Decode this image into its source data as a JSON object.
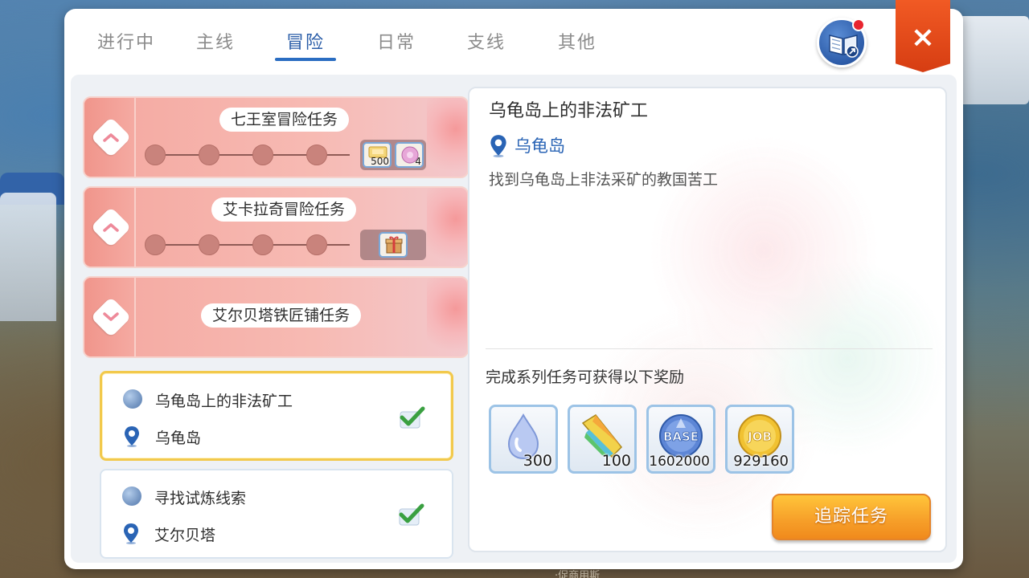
{
  "tabs": [
    {
      "label": "进行中",
      "active": false
    },
    {
      "label": "主线",
      "active": false
    },
    {
      "label": "冒险",
      "active": true
    },
    {
      "label": "日常",
      "active": false
    },
    {
      "label": "支线",
      "active": false
    },
    {
      "label": "其他",
      "active": false
    }
  ],
  "close_label": "×",
  "quest_groups": [
    {
      "title": "七王室冒险任务",
      "expanded": true,
      "reward_counts": [
        "500",
        "4"
      ]
    },
    {
      "title": "艾卡拉奇冒险任务",
      "expanded": true,
      "reward_counts": []
    },
    {
      "title": "艾尔贝塔铁匠铺任务",
      "expanded": false,
      "reward_counts": []
    }
  ],
  "quest_items": [
    {
      "name": "乌龟岛上的非法矿工",
      "location": "乌龟岛",
      "completed": true,
      "selected": true
    },
    {
      "name": "寻找试炼线索",
      "location": "艾尔贝塔",
      "completed": true,
      "selected": false
    }
  ],
  "detail": {
    "title": "乌龟岛上的非法矿工",
    "location": "乌龟岛",
    "description": "找到乌龟岛上非法采矿的教国苦工",
    "reward_title": "完成系列任务可获得以下奖励",
    "rewards": [
      {
        "icon": "droplet-icon",
        "value": "300"
      },
      {
        "icon": "crystal-icon",
        "value": "100"
      },
      {
        "icon": "base-exp-icon",
        "value": "1602000",
        "badge": "BASE"
      },
      {
        "icon": "job-exp-icon",
        "value": "929160",
        "badge": "JOB"
      }
    ],
    "track_button": "追踪任务"
  },
  "background_text": "·促商用斯",
  "colors": {
    "accent_blue": "#2a6dc2",
    "group_pink": "#f4a8a0",
    "selected_border": "#f2c94c",
    "track_orange": "#f7a12a",
    "close_red": "#e24a1c"
  }
}
